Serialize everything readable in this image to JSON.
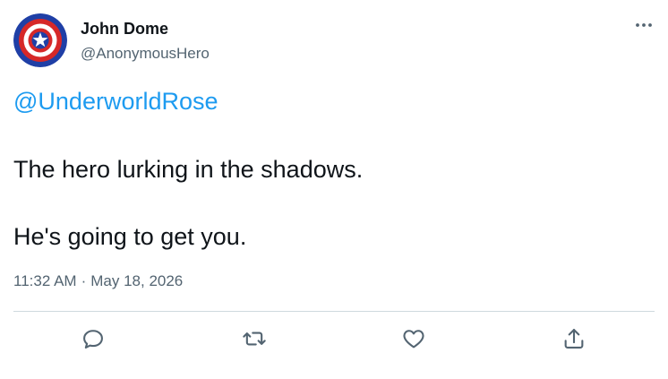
{
  "author": {
    "display_name": "John Dome",
    "handle": "@AnonymousHero",
    "avatar_icon": "shield-star-icon"
  },
  "tweet": {
    "mention": "@UnderworldRose",
    "lines": [
      "The hero lurking in the shadows.",
      "He's going to get you."
    ],
    "time": "11:32 AM",
    "separator": "·",
    "date": "May 18, 2026"
  },
  "actions": [
    {
      "icon": "reply-icon"
    },
    {
      "icon": "retweet-icon"
    },
    {
      "icon": "like-icon"
    },
    {
      "icon": "share-icon"
    }
  ],
  "colors": {
    "link": "#1d9bf0",
    "text": "#0f1419",
    "secondary": "#536471",
    "divider": "#cfd9de"
  }
}
